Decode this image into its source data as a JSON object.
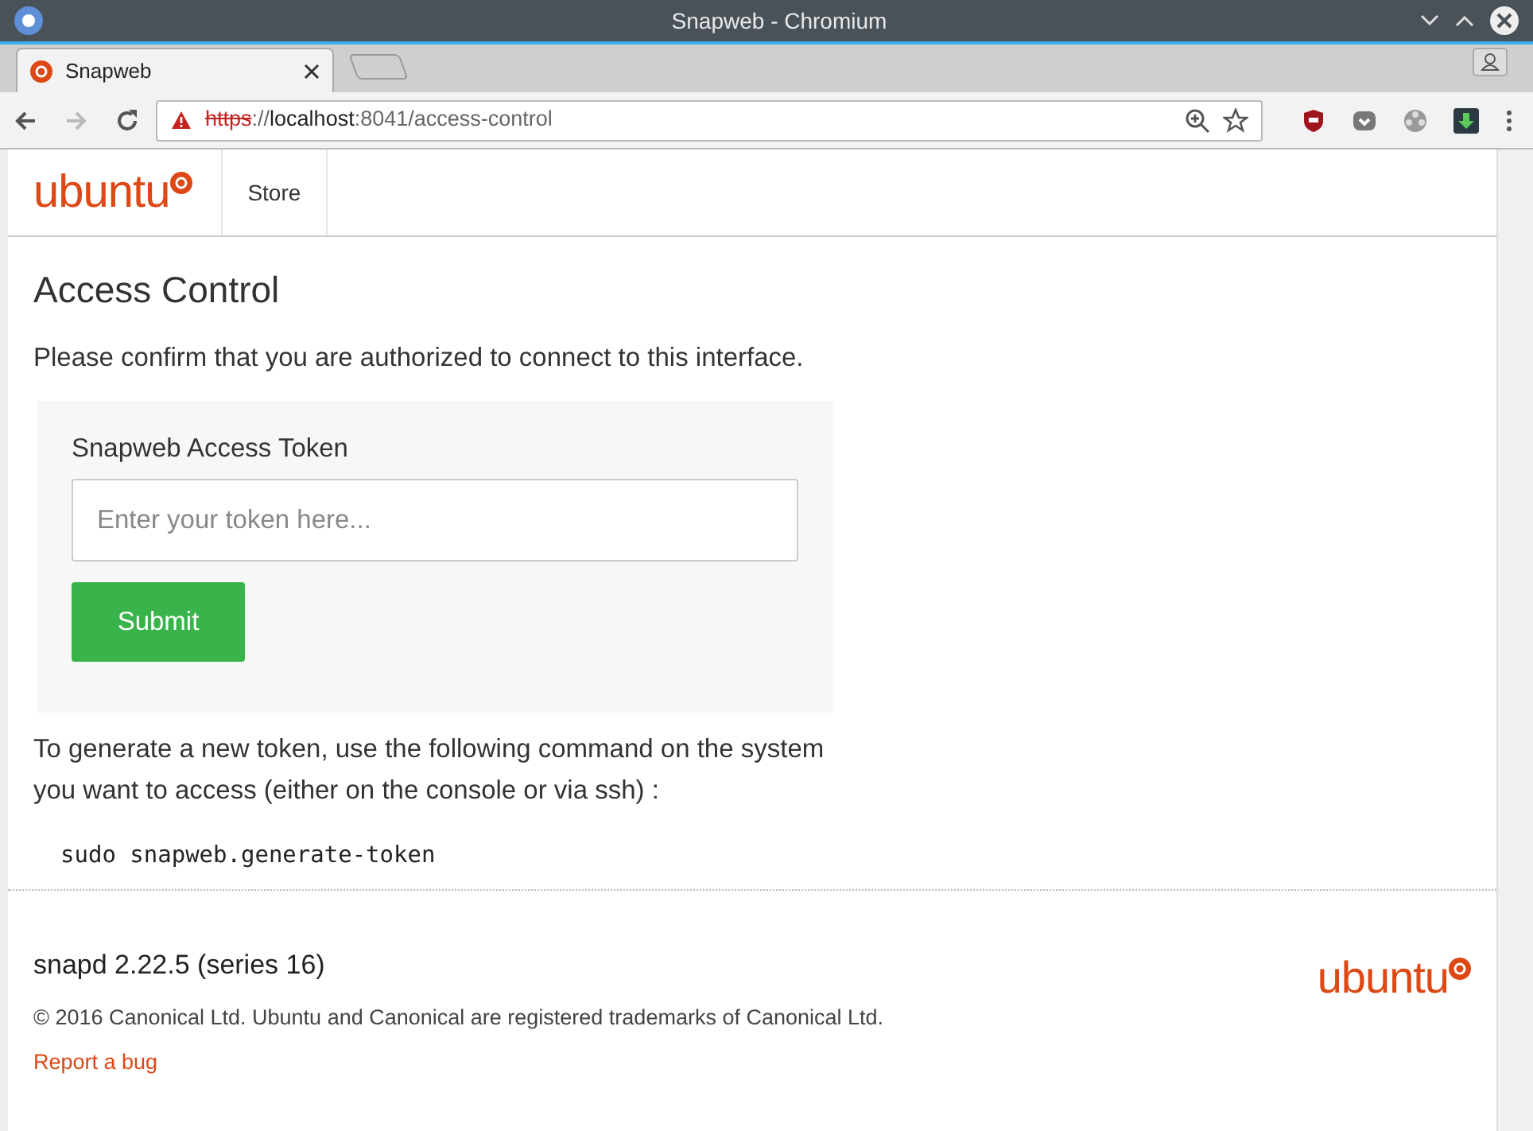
{
  "window": {
    "title": "Snapweb - Chromium"
  },
  "tabs": [
    {
      "label": "Snapweb",
      "selected": true
    }
  ],
  "address_bar": {
    "scheme": "https",
    "separator": "://",
    "host": "localhost",
    "path": ":8041/access-control",
    "insecure": true
  },
  "header": {
    "logo": "ubuntu",
    "nav": [
      {
        "label": "Store"
      }
    ]
  },
  "page": {
    "title": "Access Control",
    "intro": "Please confirm that you are authorized to connect to this interface.",
    "form": {
      "label": "Snapweb Access Token",
      "placeholder": "Enter your token here...",
      "submit": "Submit"
    },
    "help": "To generate a new token, use the following command on the system you want to access (either on the console or via ssh) :",
    "command": "sudo snapweb.generate-token"
  },
  "footer": {
    "version": "snapd 2.22.5 (series 16)",
    "copyright": "© 2016 Canonical Ltd. Ubuntu and Canonical are registered trademarks of Canonical Ltd.",
    "link": "Report a bug",
    "logo": "ubuntu"
  }
}
